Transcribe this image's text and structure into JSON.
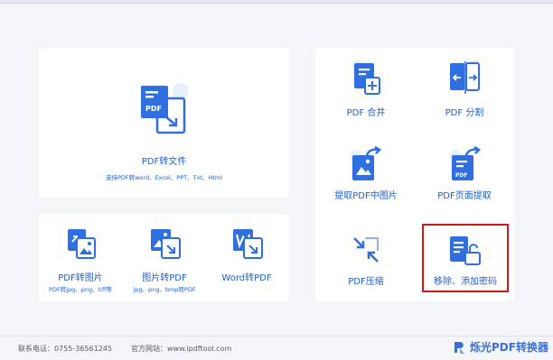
{
  "main": {
    "pdf_to_file": {
      "label": "PDF转文件",
      "sub": "支持PDF转word、Excel、PPT、Txt、Html"
    },
    "pdf_to_image": {
      "label": "PDF转图片",
      "sub": "PDF转jpg、png、tiff等"
    },
    "image_to_pdf": {
      "label": "图片转PDF",
      "sub": "jpg、png、bmp转PDF"
    },
    "word_to_pdf": {
      "label": "Word转PDF"
    },
    "pdf_merge": {
      "label": "PDF 合并"
    },
    "pdf_split": {
      "label": "PDF 分割"
    },
    "extract_images": {
      "label": "提取PDF中图片"
    },
    "extract_pages": {
      "label": "PDF页面提取"
    },
    "pdf_compress": {
      "label": "PDF压缩"
    },
    "password": {
      "label": "移除、添加密码"
    }
  },
  "footer": {
    "phone": "联系电话：0755-36561245",
    "website": "官方网站：www.ipdftool.com",
    "brand": "烁光PDF转换器"
  },
  "icons": {
    "pdf_to_file": "pdf-to-file-icon",
    "pdf_to_image": "pdf-to-image-icon",
    "image_to_pdf": "image-to-pdf-icon",
    "word_to_pdf": "word-to-pdf-icon",
    "pdf_merge": "pdf-merge-icon",
    "pdf_split": "pdf-split-icon",
    "extract_images": "extract-images-icon",
    "extract_pages": "extract-pages-icon",
    "pdf_compress": "pdf-compress-icon",
    "password": "password-lock-icon",
    "brand": "brand-logo-icon"
  },
  "colors": {
    "accent": "#1f5fd1",
    "icon_blue": "#2f6fe0",
    "highlight": "#d01818",
    "background": "#f3f5f9"
  }
}
